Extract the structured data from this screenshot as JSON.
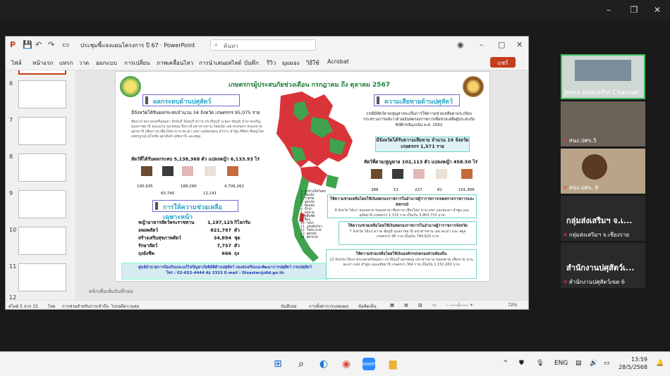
{
  "zoom_shell": {
    "restore_icon": "restore-icon",
    "close_icon": "close-icon"
  },
  "ppt": {
    "doc_title": "ประชุมชี้แจงแผนโครงการ ปี 67  ·  PowerPoint",
    "search_placeholder": "ค้นหา",
    "tabs": [
      "ไฟล์",
      "หน้าแรก",
      "แทรก",
      "วาด",
      "ออกแบบ",
      "การเปลี่ยน",
      "ภาพเคลื่อนไหว",
      "การนำเสนอสไลด์",
      "บันทึก",
      "รีวิว",
      "มุมมอง",
      "วิธีใช้",
      "Acrobat"
    ],
    "share_label": "แชร์",
    "thumb_numbers": [
      "6",
      "7",
      "8",
      "9",
      "10",
      "11",
      "12"
    ],
    "notes_placeholder": "คลิกเพื่อเพิ่มบันทึกย่อ",
    "status": {
      "slide_info": "สไลด์ 5 จาก 15",
      "lang": "ไทย",
      "accessibility": "การช่วยสำหรับการเข้าถึง: ไปรอตีความต่อ",
      "notes": "บันทึกย่อ",
      "display": "การตั้งค่าการแสดงผล",
      "comments": "ข้อคิดเห็น",
      "zoom": "72%"
    }
  },
  "slide": {
    "title": "เกษตรกรผู้ประสบภัยช่วงเดือน กรกฎาคม ถึง ตุลาคม 2567",
    "impact_head": "ผลกระทบด้านปศุสัตว์",
    "impact_summary": "มีจังหวัดได้รับผลกระทบจำนวน 34 จังหวัด เกษตรกร  95,075 ราย",
    "impact_provinces": "ชัยนาท พระนครศรีอยุธยา สิงห์บุรี จันทบุรี ตราด ปราจีนบุรี ระยอง ชัยภูมิ อำนาจเจริญ อุบลราชธานี ขอนแก่น นครพนม บึงกาฬ มหาสารคาม ร้อยเอ็ด เลย สกลนคร หนองคาย อุดรธานี เชียงราย เชียงใหม่ น่าน พะเยา แพร่ แม่ฮ่องสอน ลำปาง ลำพูน พิจิตร พิษณุโลก เพชรบูรณ์ สุโขทัย อุตรดิตถ์ อุทัยธานี และสตูล",
    "impact_animals": "สัตว์ที่ได้รับผลกระทบ     5,138,368 ตัว  แปลงหญ้า   6,133.93 ไร่",
    "impact_nums": [
      "190,935",
      "60,740",
      "168,290",
      "12,141",
      "4,706,262"
    ],
    "special_head": "การให้ความช่วยเหลือเฉพาะหน้า",
    "special_items": [
      {
        "label": "หญ้าอาหารสัตว์พระราชทาน",
        "value": "1,197,125",
        "unit": "กิโลกรัม"
      },
      {
        "label": "อพยพสัตว์",
        "value": "821,797",
        "unit": "ตัว"
      },
      {
        "label": "สร้างเสริมสุขภาพสัตว์",
        "value": "34,894",
        "unit": "ชุด"
      },
      {
        "label": "รักษาสัตว์",
        "value": "7,757",
        "unit": "ตัว"
      },
      {
        "label": "ถุงยังชีพ",
        "value": "666",
        "unit": "ถุง"
      }
    ],
    "contact_line1": "ศูนย์อำนวยการป้องกันและแก้ไขปัญหาภัยพิบัติด้านปศุสัตว์ กองส่งเสริมและพัฒนาการปศุสัตว์ กรมปศุสัตว์",
    "contact_line2": "โทร : 02-653-4444 ต่อ 3315  E-mail : Disaster@dld.go.th",
    "loss_head": "ความเสียหายด้านปศุสัตว์",
    "loss_desc": "กรณีมีสัตว์ตาย/สูญหายจะเป็นการให้ความช่วยเหลือตามระเบียบกระทรวงการคลังว่าด้วยเงินทดรองราชการเพื่อช่วยเหลือผู้ประสบภัยพิบัติกรณีฉุกเฉิน พ.ศ. 2562",
    "loss_box": "มีจังหวัดได้รับความเสียหาย จำนวน 19 จังหวัด  เกษตรกร  1,571 ราย",
    "loss_animals": "สัตว์ที่ตาย/สูญหาย   102,113 ตัว   แปลงหญ้า    458.50 ไร่",
    "loss_nums": [
      "388",
      "51",
      "227",
      "81",
      "101,366"
    ],
    "box1_hdr": "ใช้ความช่วยเหลือโดยใช้เงินทดรองราชการในอำนาจผู้ว่าราชการเขตตรวจราชการและสหกรณ์",
    "box1_body": "9 จังหวัด ได้แก่ หนองคาย หนองคาย เชียงราย เชียงใหม่ น่าน แพร่ และพะเยา ลำพูน และอุทัยธานี เกษตรกร 1,133 ราย เป็นเงิน 3,905,710 บาท",
    "box2_hdr": "ใช้ความช่วยเหลือโดยใช้เงินทดรองราชการในอำนาจผู้ว่าราชการจังหวัด",
    "box2_body": "7 จังหวัด ได้แก่ ตราด ชัยภูมิ อุบลราชธานี มหาสารคาม เลย พะเยา และ สตูล เกษตรกร 96 ราย เป็นเงิน  744,620  บาท",
    "box3_hdr": "ใช้ความช่วยเหลือโดยใช้เงินองค์กรปกครองส่วนท้องถิ่น",
    "box3_body": "12 จังหวัด ได้แก่ พระนครศรีอยุธยา ปราจีนบุรี นครพนม มหาสารคาม หนองคาย เชียงราย น่าน พะเยา แพร่ ลำพูน และอุทัยธานี เกษตรกร  364 ราย เป็นเงิน  1,152,260  บาท",
    "legend": [
      "1. ถูกบ้านกิดโคตร",
      "2. ภัยแล้ง",
      "3. วาตภัย",
      "4. อุทกภัย",
      "5. ดินถล่ม",
      "6. น้ำป่า",
      "7. ลมพายุ",
      "8. คลื่นซัด",
      "9. อื่นๆ",
      "10. ไฟป่า",
      "11. แผ่นดินไหว",
      "12. โรคระบาด",
      "13. อุทกภัย",
      "14. สัตว์ป่วย"
    ]
  },
  "participants": [
    {
      "name": "Jeera beautiful Channel",
      "muted": false,
      "active": true
    },
    {
      "name": "สนง.ปศจ.5",
      "muted": true
    },
    {
      "name": "สนง.ปศจ. 9",
      "muted": true
    },
    {
      "big_name": "กลุ่มส่งเสริมฯ  จ.เ...",
      "name": "กลุ่มส่งเสริมฯ  จ.เชียงราย",
      "muted": true
    },
    {
      "big_name": "สำนักงานปศุสัตว์เ...",
      "name": "สำนักงานปศุสัตว์เขต 6",
      "muted": true
    }
  ],
  "taskbar": {
    "lang": "ENG",
    "time": "13:59",
    "date": "28/5/2568"
  },
  "colors": {
    "accent": "#c43e1c",
    "map_red": "#d9343a",
    "map_green": "#3fa34d",
    "teal": "#2aa7c9"
  }
}
